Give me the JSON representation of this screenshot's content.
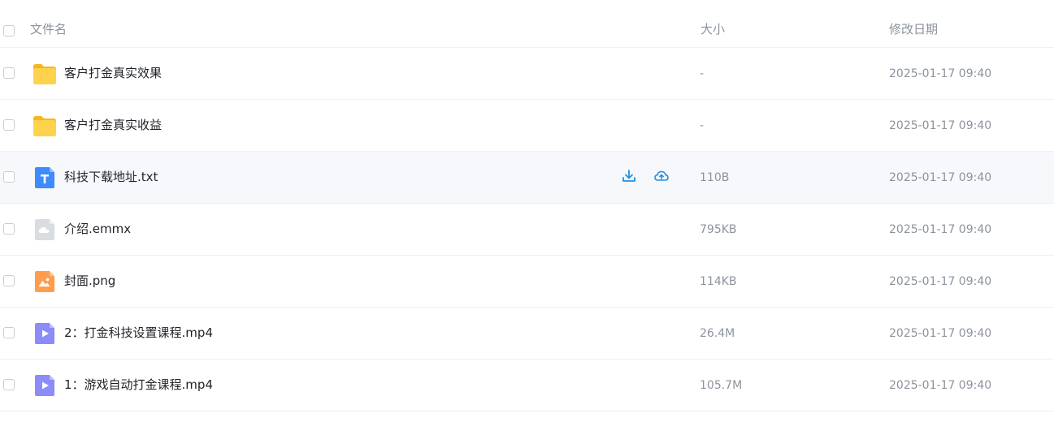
{
  "header": {
    "name_label": "文件名",
    "size_label": "大小",
    "date_label": "修改日期"
  },
  "files": [
    {
      "name": "客户打金真实效果",
      "size": "-",
      "date": "2025-01-17 09:40",
      "icon": "folder-icon"
    },
    {
      "name": "客户打金真实收益",
      "size": "-",
      "date": "2025-01-17 09:40",
      "icon": "folder-icon"
    },
    {
      "name": "科技下载地址.txt",
      "size": "110B",
      "date": "2025-01-17 09:40",
      "icon": "text-file-icon"
    },
    {
      "name": "介绍.emmx",
      "size": "795KB",
      "date": "2025-01-17 09:40",
      "icon": "cloud-file-icon"
    },
    {
      "name": "封面.png",
      "size": "114KB",
      "date": "2025-01-17 09:40",
      "icon": "image-file-icon"
    },
    {
      "name": "2：打金科技设置课程.mp4",
      "size": "26.4M",
      "date": "2025-01-17 09:40",
      "icon": "video-file-icon"
    },
    {
      "name": "1：游戏自动打金课程.mp4",
      "size": "105.7M",
      "date": "2025-01-17 09:40",
      "icon": "video-file-icon"
    }
  ],
  "hovered_row_actions": [
    "download-icon",
    "cloud-upload-icon"
  ],
  "colors": {
    "folder": "#ffc53d",
    "text_file": "#3d8bfd",
    "image_file": "#ff9d4d",
    "video_file": "#8b8cf7",
    "cloud_file": "#d5d8de",
    "action": "#1e90e6"
  }
}
